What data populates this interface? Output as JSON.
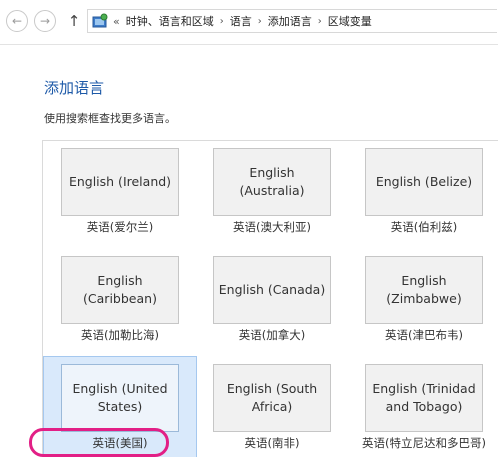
{
  "nav": {
    "back_glyph": "←",
    "forward_glyph": "→",
    "up_glyph": "↑",
    "overflow": "«",
    "breadcrumb": [
      "时钟、语言和区域",
      "语言",
      "添加语言",
      "区域变量"
    ],
    "separator": "›"
  },
  "icons": {
    "back": "back-arrow-icon",
    "forward": "forward-arrow-icon",
    "up": "up-arrow-icon",
    "location": "control-panel-icon"
  },
  "page": {
    "title": "添加语言",
    "hint": "使用搜索框查找更多语言。"
  },
  "colors": {
    "title": "#1e5aa8",
    "selected_background": "#d9e9fb",
    "highlight": "#e21f86"
  },
  "languages": [
    {
      "name": "English (Ireland)",
      "caption": "英语(爱尔兰)"
    },
    {
      "name": "English (Australia)",
      "caption": "英语(澳大利亚)"
    },
    {
      "name": "English (Belize)",
      "caption": "英语(伯利兹)"
    },
    {
      "name": "English (Caribbean)",
      "caption": "英语(加勒比海)"
    },
    {
      "name": "English (Canada)",
      "caption": "英语(加拿大)"
    },
    {
      "name": "English (Zimbabwe)",
      "caption": "英语(津巴布韦)"
    },
    {
      "name": "English (United States)",
      "caption": "英语(美国)",
      "selected": true
    },
    {
      "name": "English (South Africa)",
      "caption": "英语(南非)"
    },
    {
      "name": "English (Trinidad and Tobago)",
      "caption": "英语(特立尼达和多巴哥)"
    }
  ]
}
